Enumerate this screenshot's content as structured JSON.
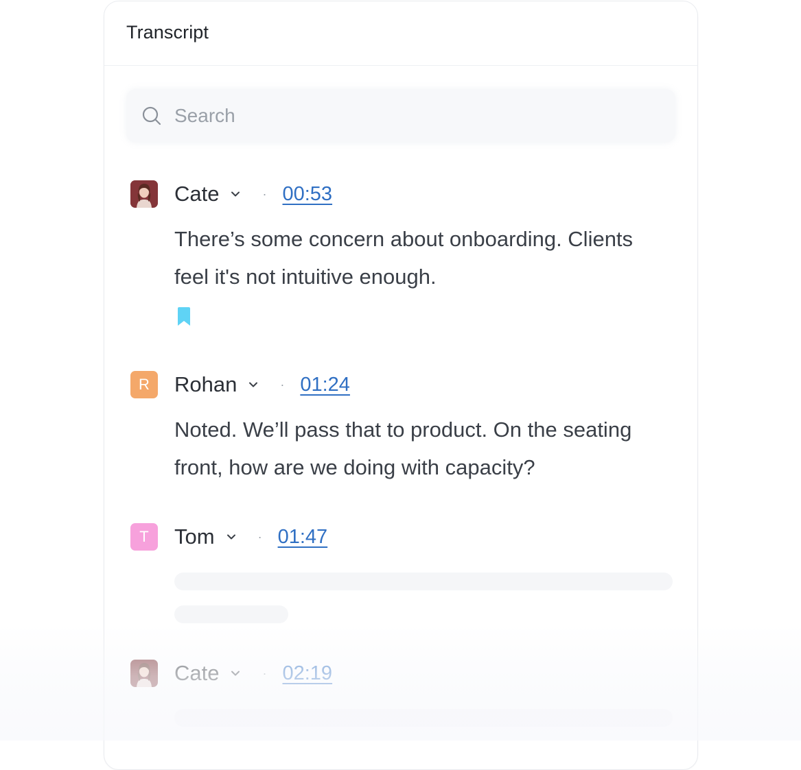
{
  "panel": {
    "title": "Transcript"
  },
  "search": {
    "placeholder": "Search",
    "value": ""
  },
  "entries": [
    {
      "speaker": "Cate",
      "time": "00:53",
      "avatar": "photo",
      "text": "There’s some concern about onboarding. Clients feel it's not intuitive enough.",
      "bookmarked": true
    },
    {
      "speaker": "Rohan",
      "time": "01:24",
      "avatar_initial": "R",
      "avatar_color": "#f4a86a",
      "text": "Noted. We’ll pass that to product. On the seating front, how are we doing with capacity?"
    },
    {
      "speaker": "Tom",
      "time": "01:47",
      "avatar_initial": "T",
      "avatar_color": "#f7a1dc",
      "text_loading": true
    },
    {
      "speaker": "Cate",
      "time": "02:19",
      "avatar": "photo",
      "text_loading": true
    }
  ],
  "icons": {
    "search": "search-icon",
    "chevron": "chevron-down-icon",
    "bookmark": "bookmark-icon"
  },
  "colors": {
    "link": "#2f6fc3",
    "bookmark": "#5fd3f5",
    "rohan_avatar": "#f4a86a",
    "tom_avatar": "#f7a1dc"
  }
}
